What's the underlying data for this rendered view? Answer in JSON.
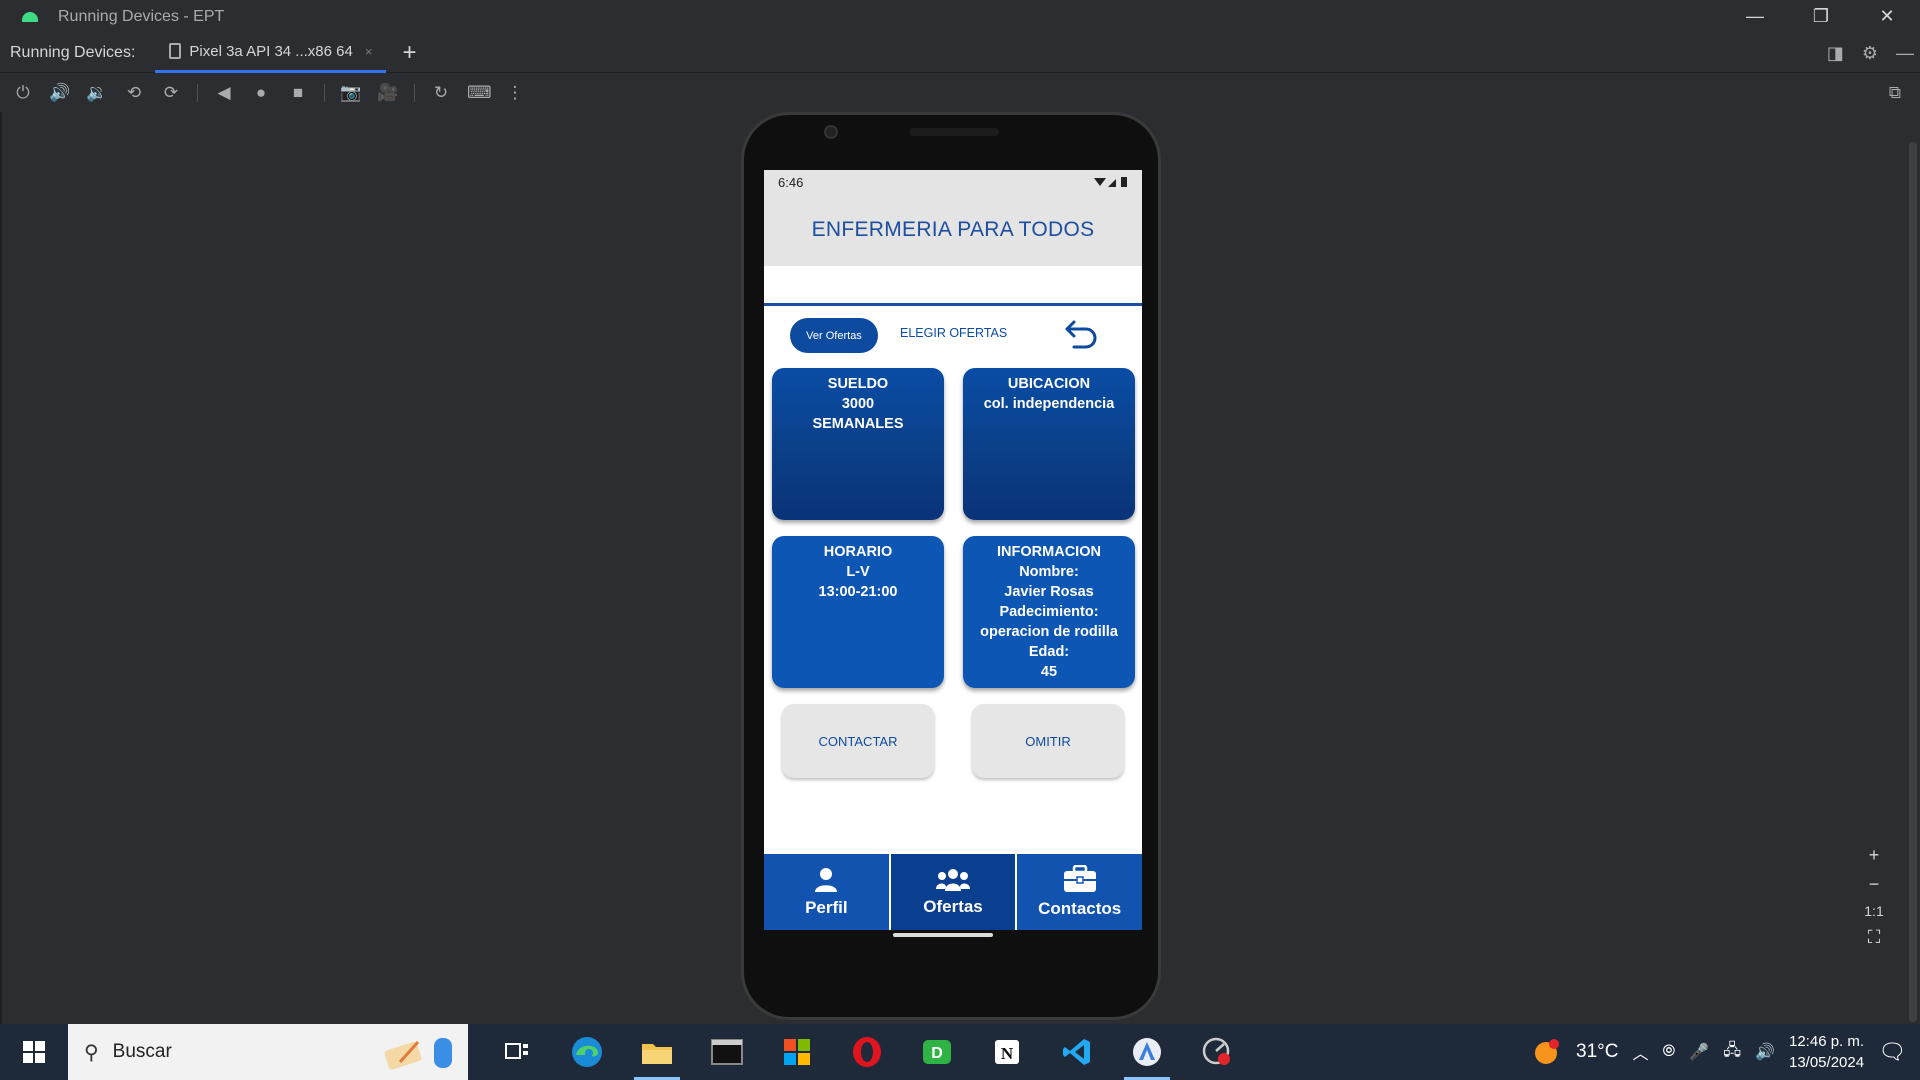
{
  "window": {
    "title": "Running Devices - EPT",
    "minimize": "—",
    "restore": "❐",
    "close": "✕"
  },
  "tabbar": {
    "label": "Running Devices:",
    "tab_label": "Pixel 3a API 34 ...x86 64",
    "tab_close": "×",
    "add": "+"
  },
  "phone": {
    "status_time": "6:46",
    "app_title": "ENFERMERIA PARA TODOS",
    "subnav": {
      "ver_ofertas": "Ver Ofertas",
      "elegir_ofertas": "ELEGIR OFERTAS"
    },
    "cards": {
      "sueldo": [
        "SUELDO",
        "3000",
        "SEMANALES"
      ],
      "ubicacion": [
        "UBICACION",
        "col. independencia"
      ],
      "horario": [
        "HORARIO",
        "L-V",
        "13:00-21:00"
      ],
      "informacion": [
        "INFORMACION",
        "Nombre:",
        "Javier Rosas",
        "Padecimiento:",
        "operacion de rodilla",
        "Edad:",
        "45"
      ]
    },
    "buttons": {
      "contactar": "CONTACTAR",
      "omitir": "OMITIR"
    },
    "nav": {
      "perfil": "Perfil",
      "ofertas": "Ofertas",
      "contactos": "Contactos"
    }
  },
  "zoom": {
    "plus": "+",
    "minus": "−",
    "one_to_one": "1:1"
  },
  "taskbar": {
    "search_placeholder": "Buscar",
    "temperature": "31°C",
    "time": "12:46 p. m.",
    "date": "13/05/2024"
  },
  "colors": {
    "brand_blue": "#0d4ba0",
    "ide_bg": "#2b2d30",
    "taskbar_bg": "#1e2a3a"
  }
}
